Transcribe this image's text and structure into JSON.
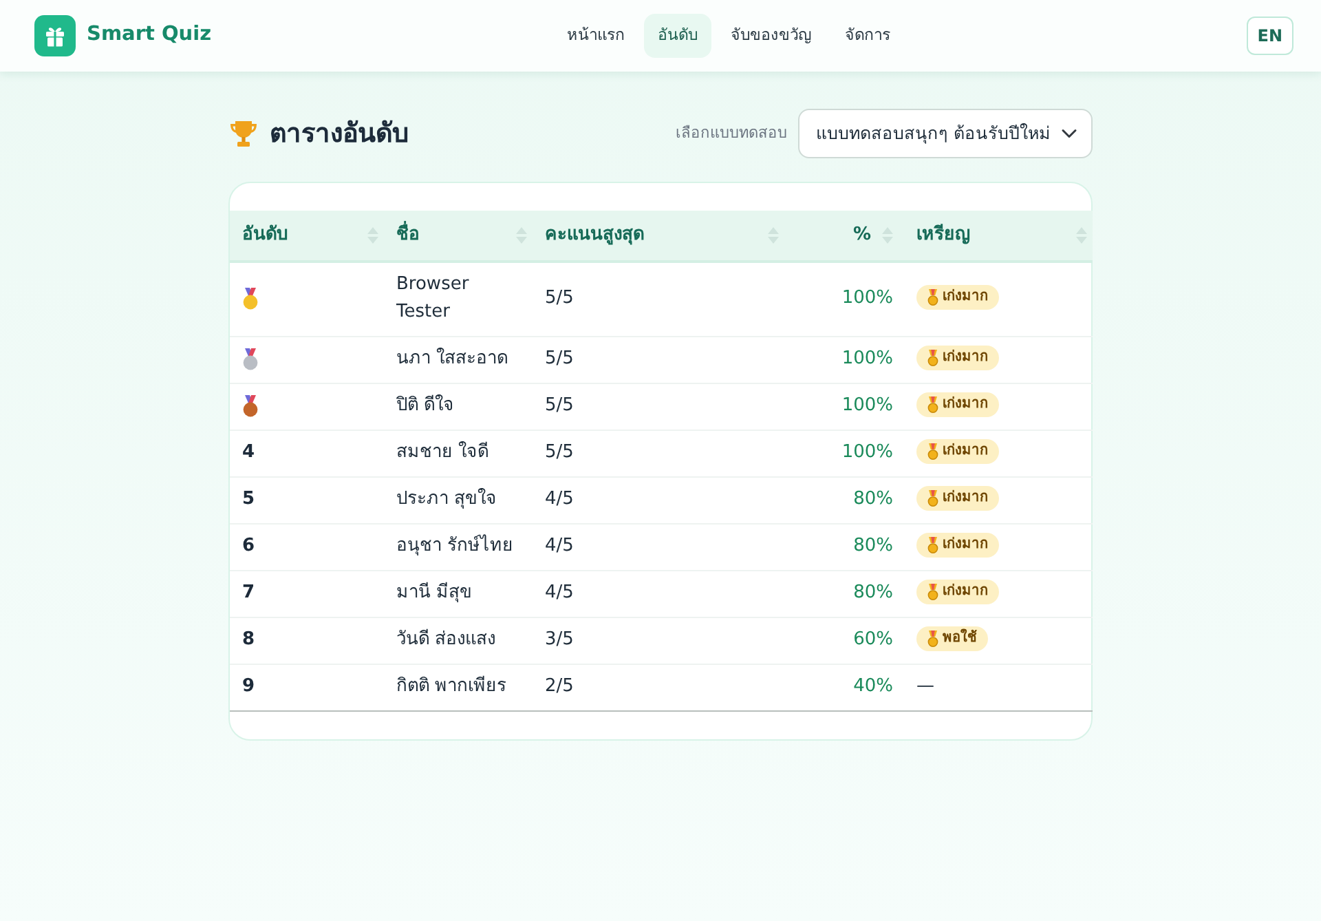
{
  "navbar": {
    "brand": "Smart Quiz",
    "links": [
      {
        "label": "หน้าแรก",
        "selected": false
      },
      {
        "label": "อันดับ",
        "selected": true
      },
      {
        "label": "จับของขวัญ",
        "selected": false
      },
      {
        "label": "จัดการ",
        "selected": false
      }
    ],
    "language_button": "EN"
  },
  "page": {
    "title": "ตารางอันดับ",
    "quiz_select": {
      "label": "เลือกแบบทดสอบ",
      "value": "แบบทดสอบสนุกๆ ต้อนรับปีใหม่"
    }
  },
  "table": {
    "columns": [
      "อันดับ",
      "ชื่อ",
      "คะแนนสูงสุด",
      "%",
      "เหรียญ"
    ],
    "rows": [
      {
        "kind": "medal",
        "color": "#f4c02a",
        "name": "Browser Tester",
        "score": "5/5",
        "percent": "100%",
        "award": {
          "kind": "badge",
          "label": "เก่งมาก"
        }
      },
      {
        "kind": "medal",
        "color": "#b9bdc4",
        "name": "นภา ใสสะอาด",
        "score": "5/5",
        "percent": "100%",
        "award": {
          "kind": "badge",
          "label": "เก่งมาก"
        }
      },
      {
        "kind": "medal",
        "color": "#c3652a",
        "name": "ปิติ ดีใจ",
        "score": "5/5",
        "percent": "100%",
        "award": {
          "kind": "badge",
          "label": "เก่งมาก"
        }
      },
      {
        "kind": "number",
        "rank": "4",
        "name": "สมชาย ใจดี",
        "score": "5/5",
        "percent": "100%",
        "award": {
          "kind": "badge",
          "label": "เก่งมาก"
        }
      },
      {
        "kind": "number",
        "rank": "5",
        "name": "ประภา สุขใจ",
        "score": "4/5",
        "percent": "80%",
        "award": {
          "kind": "badge",
          "label": "เก่งมาก"
        }
      },
      {
        "kind": "number",
        "rank": "6",
        "name": "อนุชา รักษ์ไทย",
        "score": "4/5",
        "percent": "80%",
        "award": {
          "kind": "badge",
          "label": "เก่งมาก"
        }
      },
      {
        "kind": "number",
        "rank": "7",
        "name": "มานี มีสุข",
        "score": "4/5",
        "percent": "80%",
        "award": {
          "kind": "badge",
          "label": "เก่งมาก"
        }
      },
      {
        "kind": "number",
        "rank": "8",
        "name": "วันดี ส่องแสง",
        "score": "3/5",
        "percent": "60%",
        "award": {
          "kind": "badge",
          "label": "พอใช้"
        }
      },
      {
        "kind": "number",
        "rank": "9",
        "name": "กิตติ พากเพียร",
        "score": "2/5",
        "percent": "40%",
        "award": {
          "kind": "text",
          "label": "—"
        }
      }
    ]
  }
}
